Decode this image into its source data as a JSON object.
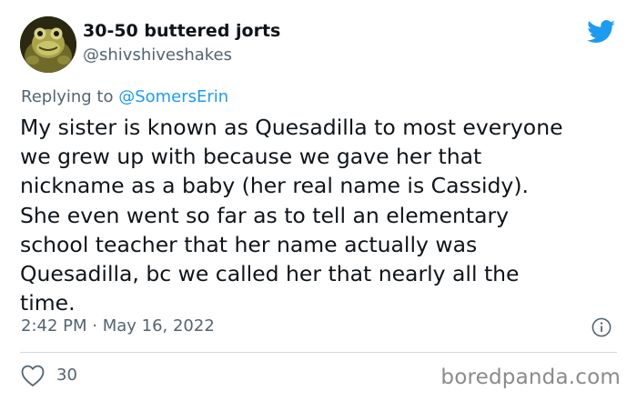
{
  "tweet": {
    "author": {
      "display_name": "30-50 buttered jorts",
      "handle": "@shivshiveshakes",
      "avatar_icon": "frog-avatar"
    },
    "platform_icon": "twitter-bird-icon",
    "reply": {
      "prefix": "Replying to ",
      "mention": "@SomersErin"
    },
    "text_lines": [
      "My sister is known as Quesadilla to most everyone",
      "we grew up with because we gave her that",
      "nickname as a baby (her real name is Cassidy).",
      "She even went so far as to tell an elementary",
      "school teacher that her name actually was",
      "Quesadilla, bc we called her that nearly all the",
      "time."
    ],
    "timestamp": "2:42 PM · May 16, 2022",
    "likes": "30"
  },
  "watermark": "boredpanda.com",
  "colors": {
    "twitter_blue": "#1d9bf0",
    "text_primary": "#0f1419",
    "text_secondary": "#536471",
    "divider": "#cfd9de",
    "watermark": "#8a8a8a"
  }
}
